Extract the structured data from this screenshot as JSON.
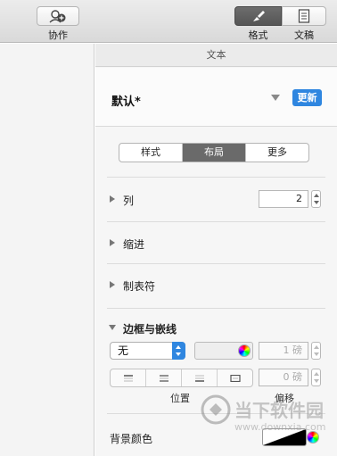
{
  "toolbar": {
    "collaborate_label": "协作",
    "format_label": "格式",
    "document_label": "文稿"
  },
  "inspector": {
    "section_title": "文本",
    "paragraph_style": "默认*",
    "update_label": "更新",
    "tabs": [
      "样式",
      "布局",
      "更多"
    ],
    "selected_tab": "布局",
    "columns": {
      "label": "列",
      "value": "2"
    },
    "indents_label": "缩进",
    "tabs_label": "制表符",
    "borders": {
      "label": "边框与嵌线",
      "line_style": "无",
      "width_value": "1 磅",
      "offset_value": "0 磅",
      "position_label": "位置",
      "offset_label": "偏移"
    },
    "background": {
      "label": "背景颜色"
    }
  },
  "watermark": {
    "name": "当下软件园",
    "url": "www.downxia.com"
  }
}
